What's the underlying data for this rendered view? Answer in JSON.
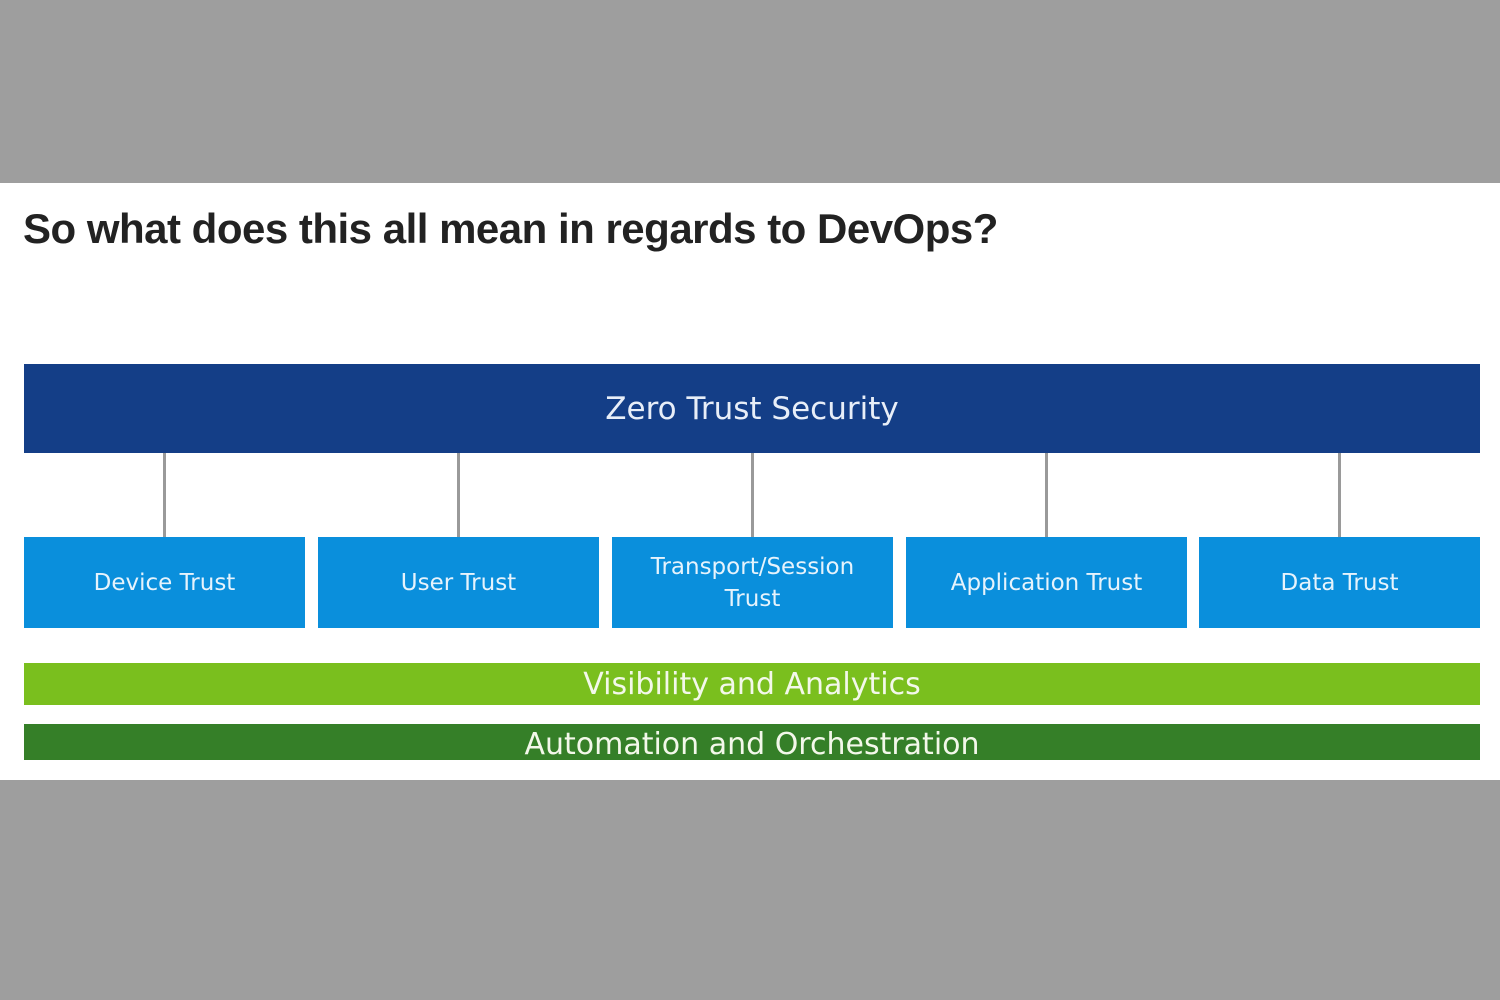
{
  "heading": "So what does this all mean in regards to DevOps?",
  "diagram": {
    "top": "Zero Trust Security",
    "pillars": [
      "Device Trust",
      "User Trust",
      "Transport/Session Trust",
      "Application Trust",
      "Data Trust"
    ],
    "bands": [
      "Visibility and Analytics",
      "Automation and Orchestration"
    ]
  },
  "colors": {
    "top": "#143e87",
    "pillar": "#0a8fdc",
    "visibility": "#7abf1e",
    "automation": "#357f28",
    "connector": "#9a9a9a",
    "backdrop": "#9e9e9e"
  }
}
